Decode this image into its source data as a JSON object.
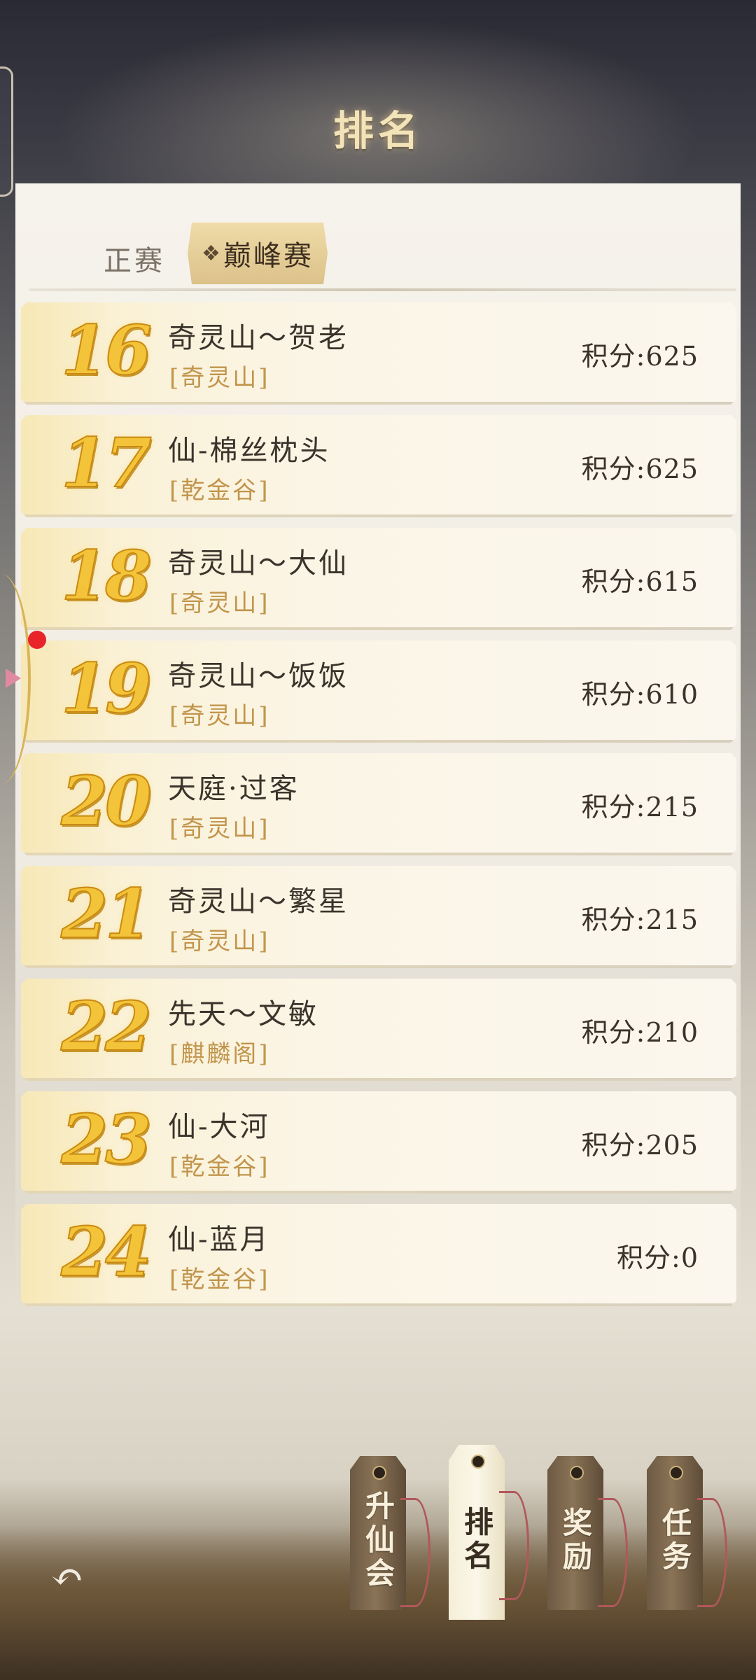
{
  "header": {
    "title": "排名"
  },
  "tabs": {
    "main_label": "正赛",
    "peak_marker": "❖",
    "peak_label": "巅峰赛"
  },
  "rankings": [
    {
      "rank": "16",
      "name": "奇灵山～贺老",
      "guild": "[奇灵山]",
      "score": "积分:625"
    },
    {
      "rank": "17",
      "name": "仙-棉丝枕头",
      "guild": "[乾金谷]",
      "score": "积分:625"
    },
    {
      "rank": "18",
      "name": "奇灵山～大仙",
      "guild": "[奇灵山]",
      "score": "积分:615"
    },
    {
      "rank": "19",
      "name": "奇灵山～饭饭",
      "guild": "[奇灵山]",
      "score": "积分:610"
    },
    {
      "rank": "20",
      "name": "天庭·过客",
      "guild": "[奇灵山]",
      "score": "积分:215"
    },
    {
      "rank": "21",
      "name": "奇灵山～繁星",
      "guild": "[奇灵山]",
      "score": "积分:215"
    },
    {
      "rank": "22",
      "name": "先天～文敏",
      "guild": "[麒麟阁]",
      "score": "积分:210"
    },
    {
      "rank": "23",
      "name": "仙-大河",
      "guild": "[乾金谷]",
      "score": "积分:205"
    },
    {
      "rank": "24",
      "name": "仙-蓝月",
      "guild": "[乾金谷]",
      "score": "积分:0"
    }
  ],
  "bottom_nav": {
    "ascend": "升仙会",
    "ranking": "排名",
    "rewards": "奖励",
    "tasks": "任务",
    "active": "ranking"
  },
  "icons": {
    "back": "back-arrow-icon"
  },
  "colors": {
    "title": "#f3e3b8",
    "rank_gold": "#f3c339",
    "guild_tan": "#c1954c",
    "notify_red": "#e8232a"
  }
}
